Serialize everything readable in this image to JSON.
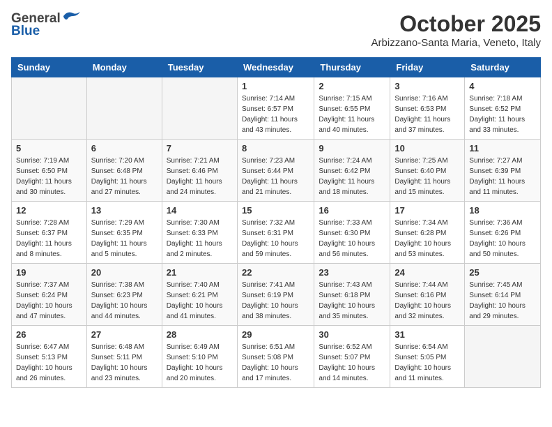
{
  "header": {
    "logo_general": "General",
    "logo_blue": "Blue",
    "month_title": "October 2025",
    "location": "Arbizzano-Santa Maria, Veneto, Italy"
  },
  "days_of_week": [
    "Sunday",
    "Monday",
    "Tuesday",
    "Wednesday",
    "Thursday",
    "Friday",
    "Saturday"
  ],
  "weeks": [
    [
      {
        "day": "",
        "info": ""
      },
      {
        "day": "",
        "info": ""
      },
      {
        "day": "",
        "info": ""
      },
      {
        "day": "1",
        "info": "Sunrise: 7:14 AM\nSunset: 6:57 PM\nDaylight: 11 hours\nand 43 minutes."
      },
      {
        "day": "2",
        "info": "Sunrise: 7:15 AM\nSunset: 6:55 PM\nDaylight: 11 hours\nand 40 minutes."
      },
      {
        "day": "3",
        "info": "Sunrise: 7:16 AM\nSunset: 6:53 PM\nDaylight: 11 hours\nand 37 minutes."
      },
      {
        "day": "4",
        "info": "Sunrise: 7:18 AM\nSunset: 6:52 PM\nDaylight: 11 hours\nand 33 minutes."
      }
    ],
    [
      {
        "day": "5",
        "info": "Sunrise: 7:19 AM\nSunset: 6:50 PM\nDaylight: 11 hours\nand 30 minutes."
      },
      {
        "day": "6",
        "info": "Sunrise: 7:20 AM\nSunset: 6:48 PM\nDaylight: 11 hours\nand 27 minutes."
      },
      {
        "day": "7",
        "info": "Sunrise: 7:21 AM\nSunset: 6:46 PM\nDaylight: 11 hours\nand 24 minutes."
      },
      {
        "day": "8",
        "info": "Sunrise: 7:23 AM\nSunset: 6:44 PM\nDaylight: 11 hours\nand 21 minutes."
      },
      {
        "day": "9",
        "info": "Sunrise: 7:24 AM\nSunset: 6:42 PM\nDaylight: 11 hours\nand 18 minutes."
      },
      {
        "day": "10",
        "info": "Sunrise: 7:25 AM\nSunset: 6:40 PM\nDaylight: 11 hours\nand 15 minutes."
      },
      {
        "day": "11",
        "info": "Sunrise: 7:27 AM\nSunset: 6:39 PM\nDaylight: 11 hours\nand 11 minutes."
      }
    ],
    [
      {
        "day": "12",
        "info": "Sunrise: 7:28 AM\nSunset: 6:37 PM\nDaylight: 11 hours\nand 8 minutes."
      },
      {
        "day": "13",
        "info": "Sunrise: 7:29 AM\nSunset: 6:35 PM\nDaylight: 11 hours\nand 5 minutes."
      },
      {
        "day": "14",
        "info": "Sunrise: 7:30 AM\nSunset: 6:33 PM\nDaylight: 11 hours\nand 2 minutes."
      },
      {
        "day": "15",
        "info": "Sunrise: 7:32 AM\nSunset: 6:31 PM\nDaylight: 10 hours\nand 59 minutes."
      },
      {
        "day": "16",
        "info": "Sunrise: 7:33 AM\nSunset: 6:30 PM\nDaylight: 10 hours\nand 56 minutes."
      },
      {
        "day": "17",
        "info": "Sunrise: 7:34 AM\nSunset: 6:28 PM\nDaylight: 10 hours\nand 53 minutes."
      },
      {
        "day": "18",
        "info": "Sunrise: 7:36 AM\nSunset: 6:26 PM\nDaylight: 10 hours\nand 50 minutes."
      }
    ],
    [
      {
        "day": "19",
        "info": "Sunrise: 7:37 AM\nSunset: 6:24 PM\nDaylight: 10 hours\nand 47 minutes."
      },
      {
        "day": "20",
        "info": "Sunrise: 7:38 AM\nSunset: 6:23 PM\nDaylight: 10 hours\nand 44 minutes."
      },
      {
        "day": "21",
        "info": "Sunrise: 7:40 AM\nSunset: 6:21 PM\nDaylight: 10 hours\nand 41 minutes."
      },
      {
        "day": "22",
        "info": "Sunrise: 7:41 AM\nSunset: 6:19 PM\nDaylight: 10 hours\nand 38 minutes."
      },
      {
        "day": "23",
        "info": "Sunrise: 7:43 AM\nSunset: 6:18 PM\nDaylight: 10 hours\nand 35 minutes."
      },
      {
        "day": "24",
        "info": "Sunrise: 7:44 AM\nSunset: 6:16 PM\nDaylight: 10 hours\nand 32 minutes."
      },
      {
        "day": "25",
        "info": "Sunrise: 7:45 AM\nSunset: 6:14 PM\nDaylight: 10 hours\nand 29 minutes."
      }
    ],
    [
      {
        "day": "26",
        "info": "Sunrise: 6:47 AM\nSunset: 5:13 PM\nDaylight: 10 hours\nand 26 minutes."
      },
      {
        "day": "27",
        "info": "Sunrise: 6:48 AM\nSunset: 5:11 PM\nDaylight: 10 hours\nand 23 minutes."
      },
      {
        "day": "28",
        "info": "Sunrise: 6:49 AM\nSunset: 5:10 PM\nDaylight: 10 hours\nand 20 minutes."
      },
      {
        "day": "29",
        "info": "Sunrise: 6:51 AM\nSunset: 5:08 PM\nDaylight: 10 hours\nand 17 minutes."
      },
      {
        "day": "30",
        "info": "Sunrise: 6:52 AM\nSunset: 5:07 PM\nDaylight: 10 hours\nand 14 minutes."
      },
      {
        "day": "31",
        "info": "Sunrise: 6:54 AM\nSunset: 5:05 PM\nDaylight: 10 hours\nand 11 minutes."
      },
      {
        "day": "",
        "info": ""
      }
    ]
  ]
}
